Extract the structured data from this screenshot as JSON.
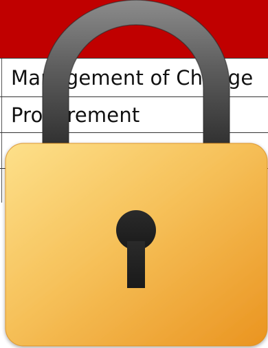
{
  "background_table": {
    "header_color": "#c00000",
    "rows": [
      {
        "label": "Management of Change"
      },
      {
        "label": "Procurement"
      },
      {
        "label": ""
      },
      {
        "label": ""
      }
    ]
  },
  "lock": {
    "icon": "padlock-icon",
    "body_color": "#f3b64a",
    "shackle_color": "#4f4f4f",
    "keyhole_color": "#222222"
  }
}
